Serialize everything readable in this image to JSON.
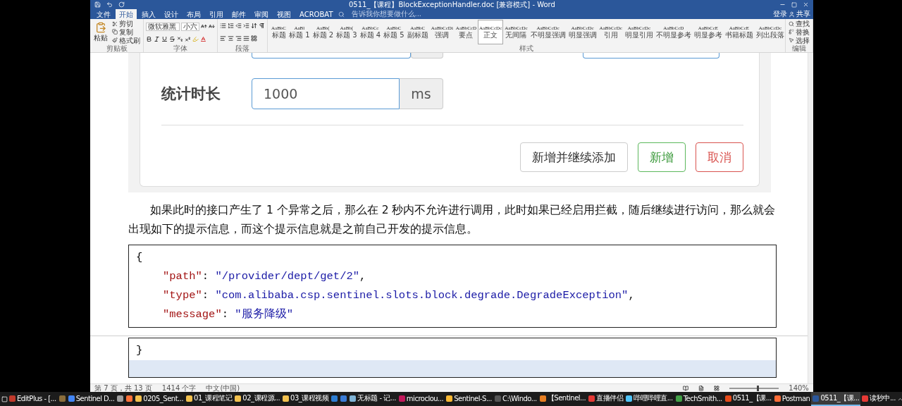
{
  "window": {
    "title": "0511_【课程】BlockExceptionHandler.doc [兼容模式] - Word"
  },
  "menu_tabs": [
    {
      "label": "文件",
      "selected": false
    },
    {
      "label": "开始",
      "selected": true
    },
    {
      "label": "插入",
      "selected": false
    },
    {
      "label": "设计",
      "selected": false
    },
    {
      "label": "布局",
      "selected": false
    },
    {
      "label": "引用",
      "selected": false
    },
    {
      "label": "邮件",
      "selected": false
    },
    {
      "label": "审阅",
      "selected": false
    },
    {
      "label": "视图",
      "selected": false
    },
    {
      "label": "ACROBAT",
      "selected": false
    }
  ],
  "search": {
    "placeholder": "告诉我你想要做什么..."
  },
  "account": {
    "sign_in": "登录",
    "share": "共享"
  },
  "ribbon": {
    "clipboard": {
      "paste": "粘贴",
      "actions": [
        "剪切",
        "复制",
        "格式刷"
      ],
      "label": "剪贴板"
    },
    "font": {
      "family": "微软雅黑",
      "size": "小六",
      "label": "字体"
    },
    "paragraph": {
      "label": "段落"
    },
    "styles": {
      "label": "样式",
      "items": [
        {
          "sample": "AaBbC",
          "name": "标题",
          "selected": false
        },
        {
          "sample": "AaBl",
          "name": "标题 1",
          "selected": false
        },
        {
          "sample": "AaBb(",
          "name": "标题 2",
          "selected": false
        },
        {
          "sample": "AaBb(",
          "name": "标题 3",
          "selected": false
        },
        {
          "sample": "AaBbCc",
          "name": "标题 4",
          "selected": false
        },
        {
          "sample": "AaBbC",
          "name": "标题 5",
          "selected": false
        },
        {
          "sample": "AaBbC",
          "name": "副标题",
          "selected": false
        },
        {
          "sample": "AaBbCcDi",
          "name": "强调",
          "selected": false
        },
        {
          "sample": "AaBbCcD",
          "name": "要点",
          "selected": false
        },
        {
          "sample": "AaBbCcDc",
          "name": "正文",
          "selected": true
        },
        {
          "sample": "AaBbCcDc",
          "name": "无间隔",
          "selected": false
        },
        {
          "sample": "AaBbCcDc",
          "name": "不明显强调",
          "selected": false
        },
        {
          "sample": "AaBbCcDc",
          "name": "明显强调",
          "selected": false
        },
        {
          "sample": "AaBbCcDc",
          "name": "引用",
          "selected": false
        },
        {
          "sample": "AaBbCcDc",
          "name": "明显引用",
          "selected": false
        },
        {
          "sample": "AaBbCcD",
          "name": "不明显参考",
          "selected": false
        },
        {
          "sample": "AaBbCcE",
          "name": "明显参考",
          "selected": false
        },
        {
          "sample": "AaBbCcE",
          "name": "书籍标题",
          "selected": false
        },
        {
          "sample": "AaBbCcDc",
          "name": "列出段落",
          "selected": false
        }
      ]
    },
    "editing": {
      "label": "编辑",
      "actions": [
        "查找",
        "替换",
        "选择"
      ]
    }
  },
  "form": {
    "field": {
      "label": "统计时长",
      "value": "1000",
      "unit": "ms"
    },
    "buttons": [
      {
        "label": "新增并继续添加",
        "kind": "default"
      },
      {
        "label": "新增",
        "kind": "success"
      },
      {
        "label": "取消",
        "kind": "danger"
      }
    ]
  },
  "paragraph": "如果此时的接口产生了 1 个异常之后，那么在 2 秒内不允许进行调用，此时如果已经启用拦截，随后继续进行访问，那么就会出现如下的提示信息，而这个提示信息就是之前自己开发的提示信息。",
  "code": {
    "lines": [
      {
        "kind": "brace",
        "text": "{"
      },
      {
        "kind": "pair",
        "key": "\"path\"",
        "colon": ": ",
        "value": "\"/provider/dept/get/2\"",
        "end": ","
      },
      {
        "kind": "pair",
        "key": "\"type\"",
        "colon": ": ",
        "value": "\"com.alibaba.csp.sentinel.slots.block.degrade.DegradeException\"",
        "end": ","
      },
      {
        "kind": "pair",
        "key": "\"message\"",
        "colon": ": ",
        "value": "\"服务降级\""
      }
    ]
  },
  "code_continued": {
    "lines": [
      {
        "kind": "brace",
        "text": "}"
      }
    ]
  },
  "status_bar": {
    "page": "第 7 页，共 13 页",
    "words": "1414 个字",
    "language": "中文(中国)",
    "zoom": {
      "reading": "140%",
      "level": 0.55
    }
  },
  "taskbar": {
    "items": [
      {
        "label": "EditPlus - [...",
        "color": "#c0392b",
        "selected": false
      },
      {
        "color": "#8a6d3b",
        "selected": false
      },
      {
        "label": "Sentinel D...",
        "color": "#4285f4",
        "selected": false
      },
      {
        "color": "#9e9e9e",
        "selected": false
      },
      {
        "color": "#ff7139",
        "selected": false
      },
      {
        "label": "0205_Sent...",
        "color": "#f2c14e",
        "selected": false
      },
      {
        "label": "01_课程笔记",
        "color": "#f2c14e",
        "selected": false
      },
      {
        "label": "02_课程源...",
        "color": "#f2c14e",
        "selected": false
      },
      {
        "label": "03_课程视频",
        "color": "#f2c14e",
        "selected": false
      },
      {
        "color": "#2d7dd2",
        "selected": false
      },
      {
        "color": "#3a7bd5",
        "selected": false
      },
      {
        "label": "无标题 - 记...",
        "color": "#7fb3d5",
        "selected": false
      },
      {
        "label": "microclou...",
        "color": "#c2185b",
        "selected": false
      },
      {
        "label": "Sentinel-S...",
        "color": "#f7b733",
        "selected": false
      },
      {
        "label": "C:\\Windo...",
        "color": "#555555",
        "selected": false
      },
      {
        "label": "【Sentinel...",
        "color": "#e67e22",
        "selected": false
      },
      {
        "label": "直播伴侣",
        "color": "#e53935",
        "selected": false
      },
      {
        "label": "哔哩哔哩直...",
        "color": "#4fc3f7",
        "selected": false
      },
      {
        "label": "TechSmith...",
        "color": "#43a047",
        "selected": false
      },
      {
        "label": "0511_【课...",
        "color": "#e64a19",
        "selected": false
      },
      {
        "label": "Postman",
        "color": "#ff6c37",
        "selected": false
      },
      {
        "label": "0511_【课...",
        "color": "#2b579a",
        "selected": true
      },
      {
        "label": "读秒中...",
        "color": "#e53935",
        "selected": false
      }
    ]
  }
}
